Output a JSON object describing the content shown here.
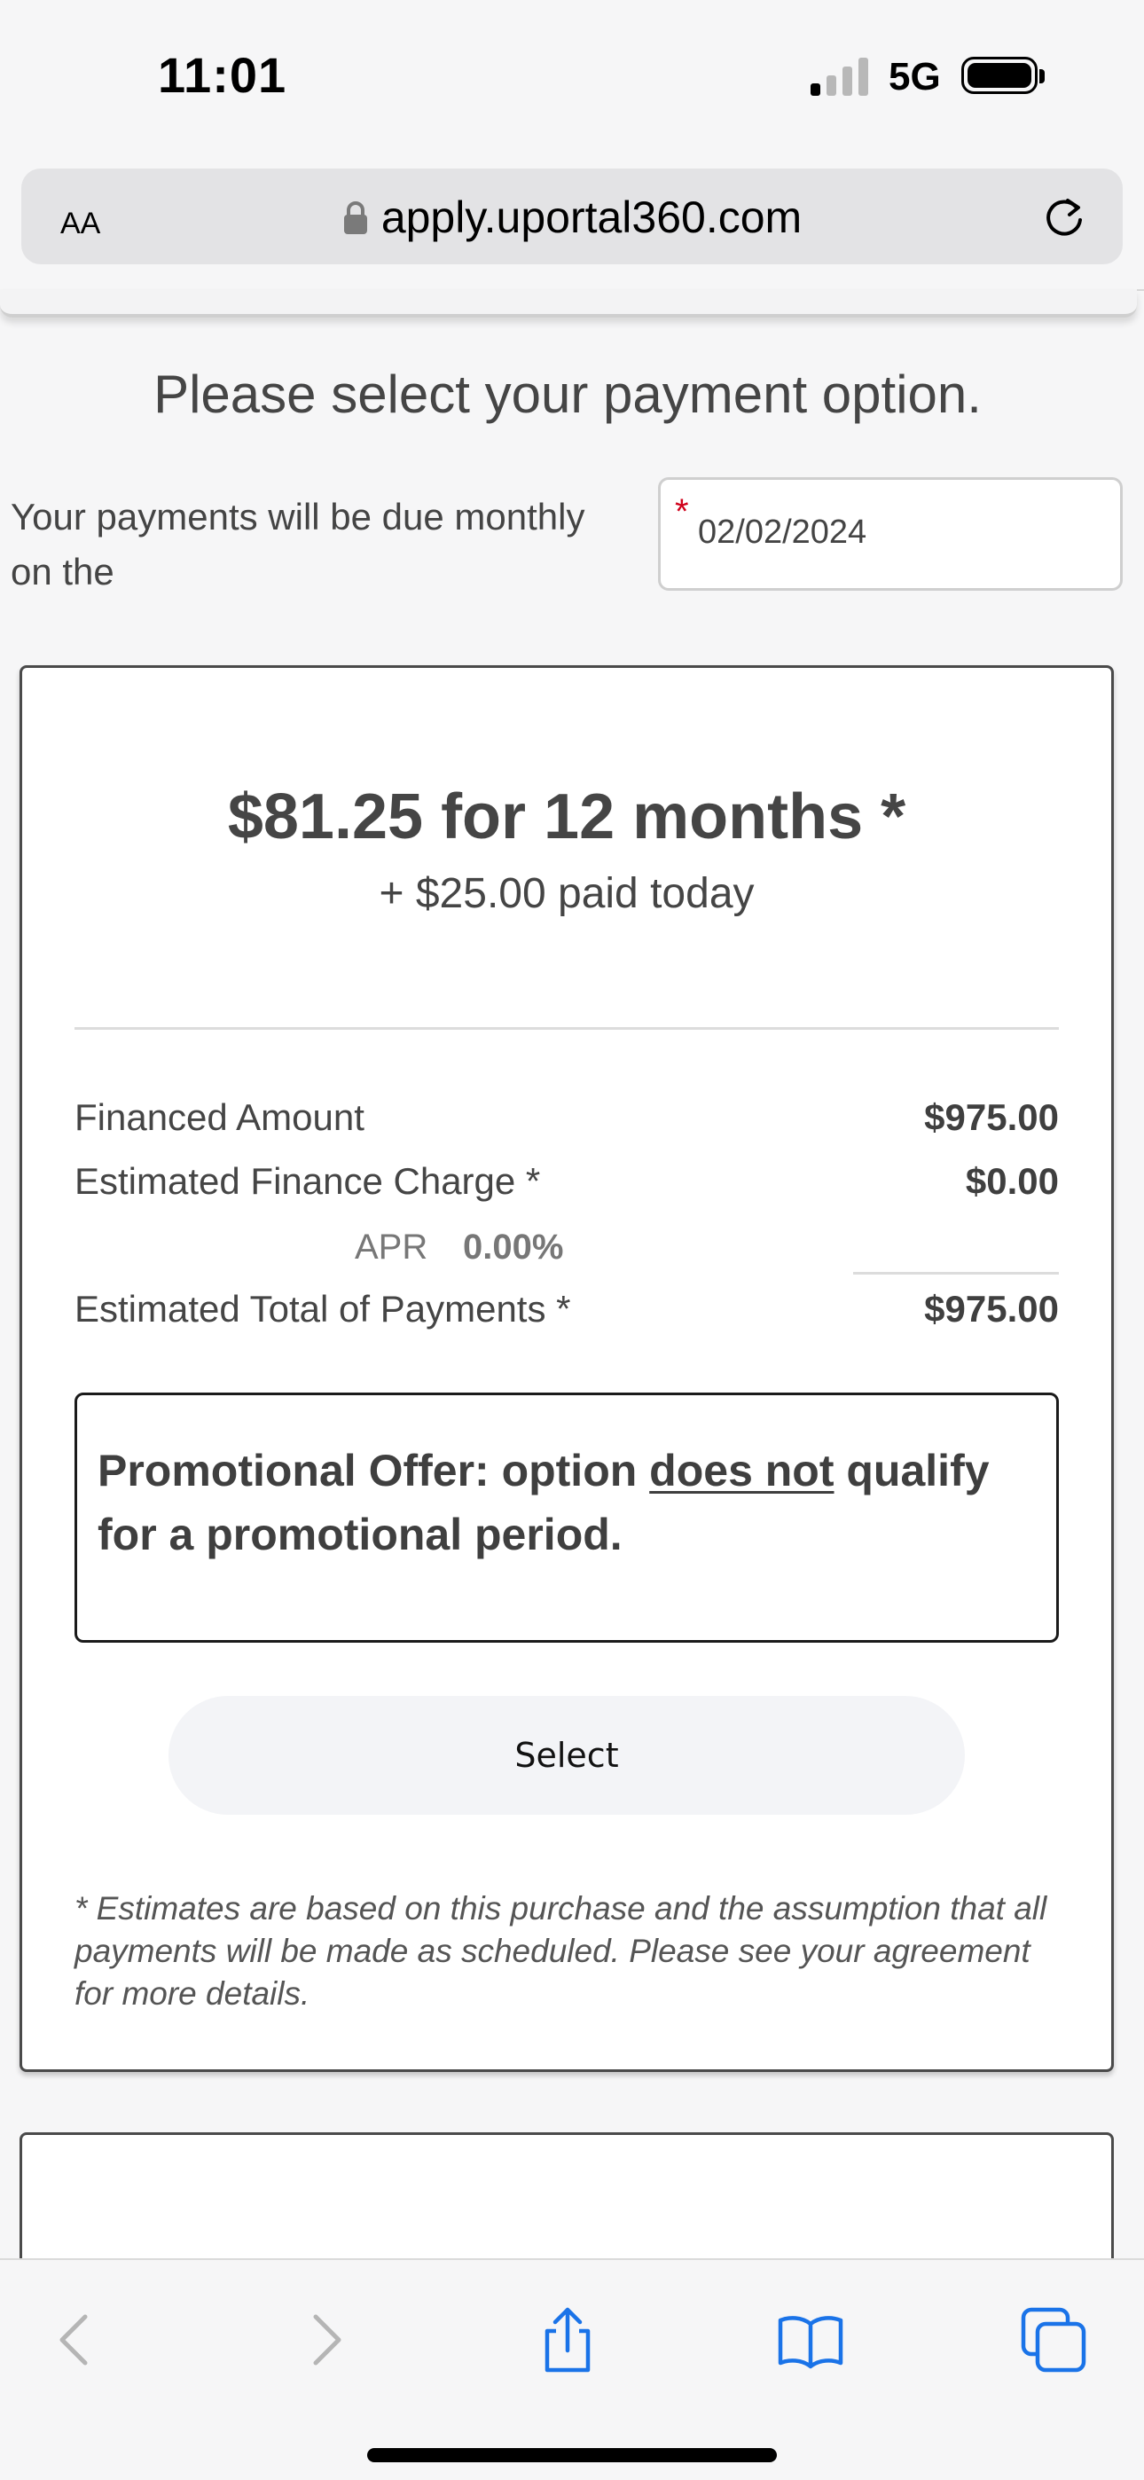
{
  "status_bar": {
    "time": "11:01",
    "network": "5G"
  },
  "browser": {
    "aa_label": "AA",
    "url": "apply.uportal360.com"
  },
  "page": {
    "title": "Please select your payment option.",
    "due_text": "Your payments will be due monthly on the",
    "due_date": "02/02/2024",
    "required_marker": "*"
  },
  "option": {
    "headline": "$81.25 for 12 months *",
    "subline": "+ $25.00 paid today",
    "rows": [
      {
        "label": "Financed Amount",
        "value": "$975.00"
      },
      {
        "label": "Estimated Finance Charge *",
        "value": "$0.00"
      },
      {
        "label": "Estimated Total of Payments *",
        "value": "$975.00"
      }
    ],
    "apr_label": "APR",
    "apr_value": "0.00%",
    "promo": {
      "prefix": "Promotional Offer: option ",
      "emphasis": "does not",
      "suffix": " qualify for a promotional period."
    },
    "select_label": "Select",
    "footnote": "* Estimates are based on this purchase and the assumption that all payments will be made as scheduled. Please see your agreement for more details."
  },
  "colors": {
    "accent_blue": "#1a73e8",
    "required_red": "#d0021b",
    "text": "#454545"
  }
}
